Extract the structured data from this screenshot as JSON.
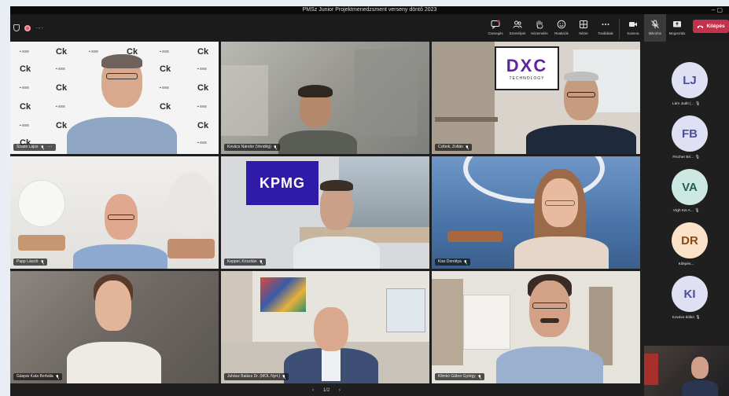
{
  "window": {
    "title": "PMSz Junior Projektmenedzsment verseny döntő 2023",
    "controls": "–  ▢"
  },
  "toolbar": {
    "items": [
      {
        "icon": "chat-icon",
        "label": "Csevegés"
      },
      {
        "icon": "people-icon",
        "label": "Személyek"
      },
      {
        "icon": "raise-hand-icon",
        "label": "Kézemelés"
      },
      {
        "icon": "reaction-icon",
        "label": "Reakciók"
      },
      {
        "icon": "view-icon",
        "label": "Nézet"
      },
      {
        "icon": "more-icon",
        "label": "Továbbiak"
      }
    ],
    "camera_label": "Kamera",
    "mic_label": "Mikrofon",
    "share_label": "Megosztás",
    "leave_label": "Kilépés"
  },
  "tiles": [
    {
      "name": "Szabó Lajos",
      "more": "···"
    },
    {
      "name": "Kovács Nándor (Vendég)"
    },
    {
      "name": "Czibok, Zoltán"
    },
    {
      "name": "Papp László"
    },
    {
      "name": "Keppel, Krisztián"
    },
    {
      "name": "Kiss Dorottya"
    },
    {
      "name": "Gáspár Kata Borbála"
    },
    {
      "name": "Juhász Balázs Dr. (MOL Nyrt.)"
    },
    {
      "name": "Klimkó Gábor György"
    }
  ],
  "logos": {
    "dxc_mark": "DXC",
    "dxc_sub": "TECHNOLOGY",
    "kpmg": "KPMG"
  },
  "participants": [
    {
      "initials": "LJ",
      "name": "Lám Judit (...",
      "color": "#dfe0f4",
      "text_color": "#4a4e9b"
    },
    {
      "initials": "FB",
      "name": "Fischer Bri...",
      "color": "#dfe0f4",
      "text_color": "#4a4e9b"
    },
    {
      "initials": "VA",
      "name": "Vígh Kis A...",
      "color": "#cde8e3",
      "text_color": "#215e53"
    },
    {
      "initials": "DR",
      "name": "Kilépés...",
      "color": "#fbe2c8",
      "text_color": "#8a4a13"
    },
    {
      "initials": "KI",
      "name": "Kovács Ildikó",
      "color": "#dfe0f4",
      "text_color": "#4a4e9b"
    }
  ],
  "pager": {
    "prev": "‹",
    "label": "1/2",
    "next": "›"
  },
  "colors": {
    "leave": "#c4314b",
    "app_bg": "#1f1f1f"
  }
}
